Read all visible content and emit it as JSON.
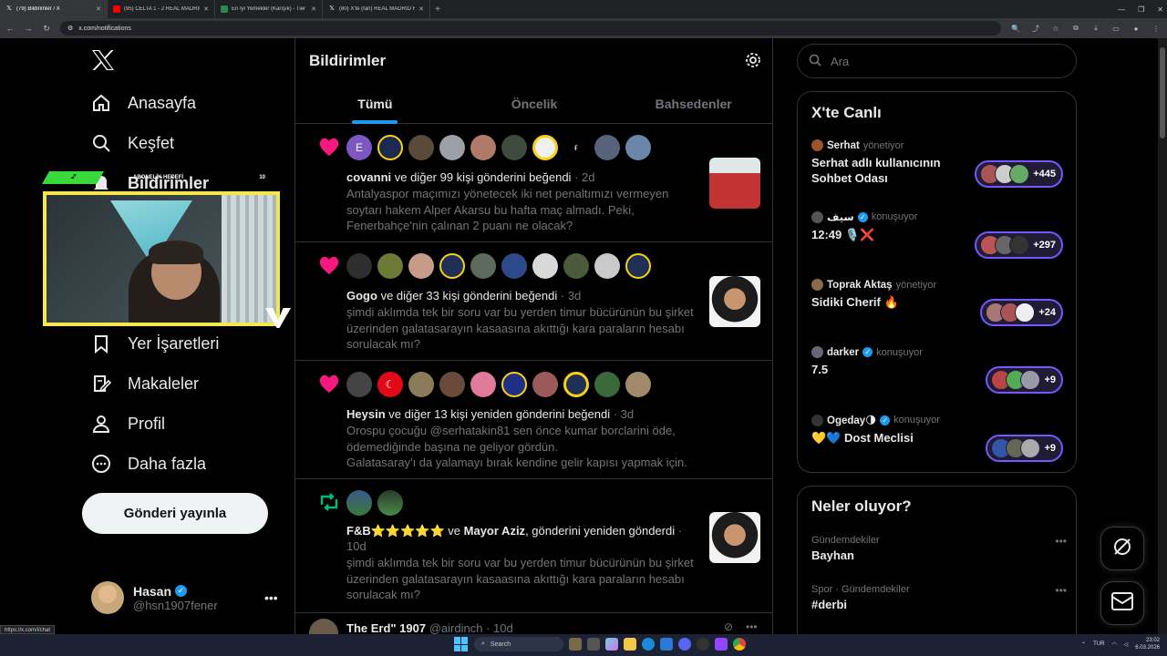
{
  "browser": {
    "tabs": [
      {
        "title": "(79) Bildirimler / X",
        "active": true,
        "icon": "x-icon"
      },
      {
        "title": "(95) CELTA 1 - 2 REAL MADRID",
        "active": false,
        "icon": "youtube-icon"
      },
      {
        "title": "En İyi Yemekler (Karışık) - Tier li",
        "active": false,
        "icon": "tier-icon"
      },
      {
        "title": "(80) X'te (fan) REAL MADRID Fi",
        "active": false,
        "icon": "x-icon"
      }
    ],
    "url": "x.com/notifications",
    "status_url": "https://x.com/i/chat"
  },
  "sidebar": {
    "items": [
      {
        "label": "Anasayfa",
        "icon": "home-icon"
      },
      {
        "label": "Keşfet",
        "icon": "search-icon"
      },
      {
        "label": "Bildirimler",
        "icon": "bell-icon"
      },
      {
        "label": "Yer İşaretleri",
        "icon": "bookmark-icon"
      },
      {
        "label": "Makaleler",
        "icon": "article-icon"
      },
      {
        "label": "Profil",
        "icon": "profile-icon"
      },
      {
        "label": "Daha fazla",
        "icon": "more-circle-icon"
      }
    ],
    "post_button": "Gönderi yayınla",
    "profile": {
      "name": "Hasan",
      "handle": "@hsn1907fener"
    }
  },
  "overlay": {
    "bar_left": "2",
    "bar_label": "ABONELİK HEDEFİ",
    "bar_right": "10"
  },
  "main": {
    "title": "Bildirimler",
    "tabs": [
      "Tümü",
      "Öncelik",
      "Bahsedenler"
    ],
    "notifications": [
      {
        "type": "like",
        "actor": "covanni",
        "action": "ve diğer 99 kişi gönderini beğendi",
        "time": "· 2d",
        "body": "Antalyaspor maçımızı yönetecek iki net penaltımızı vermeyen soytarı hakem Alper Akarsu bu hafta maç almadı. Peki, Fenerbahçe'nin çalınan 2 puanı ne olacak?"
      },
      {
        "type": "like",
        "actor": "Gogo",
        "action": "ve diğer 33 kişi gönderini beğendi",
        "time": "· 3d",
        "body": "şimdi aklımda tek bir soru var bu yerden timur bücürünün bu şirket üzerinden galatasarayın kasaasına akıttığı kara paraların hesabı sorulacak mı?"
      },
      {
        "type": "like",
        "actor": "Heysin",
        "action": "ve diğer 13 kişi yeniden gönderini beğendi",
        "time": "· 3d",
        "body": "Orospu çocuğu @serhatakin81 sen önce kumar borclarini öde, ödemediğinde başına ne geliyor gördün.\nGalatasaray'ı da yalamayı bırak kendine gelir kapısı yapmak için."
      },
      {
        "type": "repost",
        "actor": "F&B⭐⭐⭐⭐⭐",
        "connector": "ve",
        "actor2": "Mayor Aziz",
        "action": ", gönderini yeniden gönderdi",
        "time": "· 10d",
        "body": "şimdi aklımda tek bir soru var bu yerden timur bücürünün bu şirket üzerinden galatasarayın kasaasına akıttığı kara paraların hesabı sorulacak mı?"
      },
      {
        "type": "post",
        "actor": "The Erd\" 1907",
        "handle": "@airdinch",
        "time": "· 10d"
      }
    ]
  },
  "right": {
    "search_placeholder": "Ara",
    "live": {
      "title": "X'te Canlı",
      "items": [
        {
          "host": "Serhat",
          "role": "yönetiyor",
          "title": "Serhat adlı kullanıcının Sohbet Odası",
          "count": "+445",
          "verified": false
        },
        {
          "host": "سيف",
          "role": "konuşuyor",
          "title": "12:49 🎙️❌",
          "count": "+297",
          "verified": true
        },
        {
          "host": "Toprak Aktaş",
          "role": "yönetiyor",
          "title": "Sidiki Cherif 🔥",
          "count": "+24",
          "verified": false
        },
        {
          "host": "darker",
          "role": "konuşuyor",
          "title": "7.5",
          "count": "+9",
          "verified": true
        },
        {
          "host": "Ogeday🌗",
          "role": "konuşuyor",
          "title": "💛💙 Dost Meclisi",
          "count": "+9",
          "verified": true
        }
      ]
    },
    "trends": {
      "title": "Neler oluyor?",
      "items": [
        {
          "category": "Gündemdekiler",
          "name": "Bayhan"
        },
        {
          "category": "Spor · Gündemdekiler",
          "name": "#derbi"
        }
      ]
    }
  },
  "taskbar": {
    "search": "Search",
    "lang": "TUR",
    "time": "23:02",
    "date": "6.03.2026"
  },
  "colors": {
    "accent": "#1d9bf0",
    "like": "#f91880",
    "repost": "#00ba7c",
    "live_border": "#7856ff",
    "overlay_border": "#f5e84a"
  }
}
